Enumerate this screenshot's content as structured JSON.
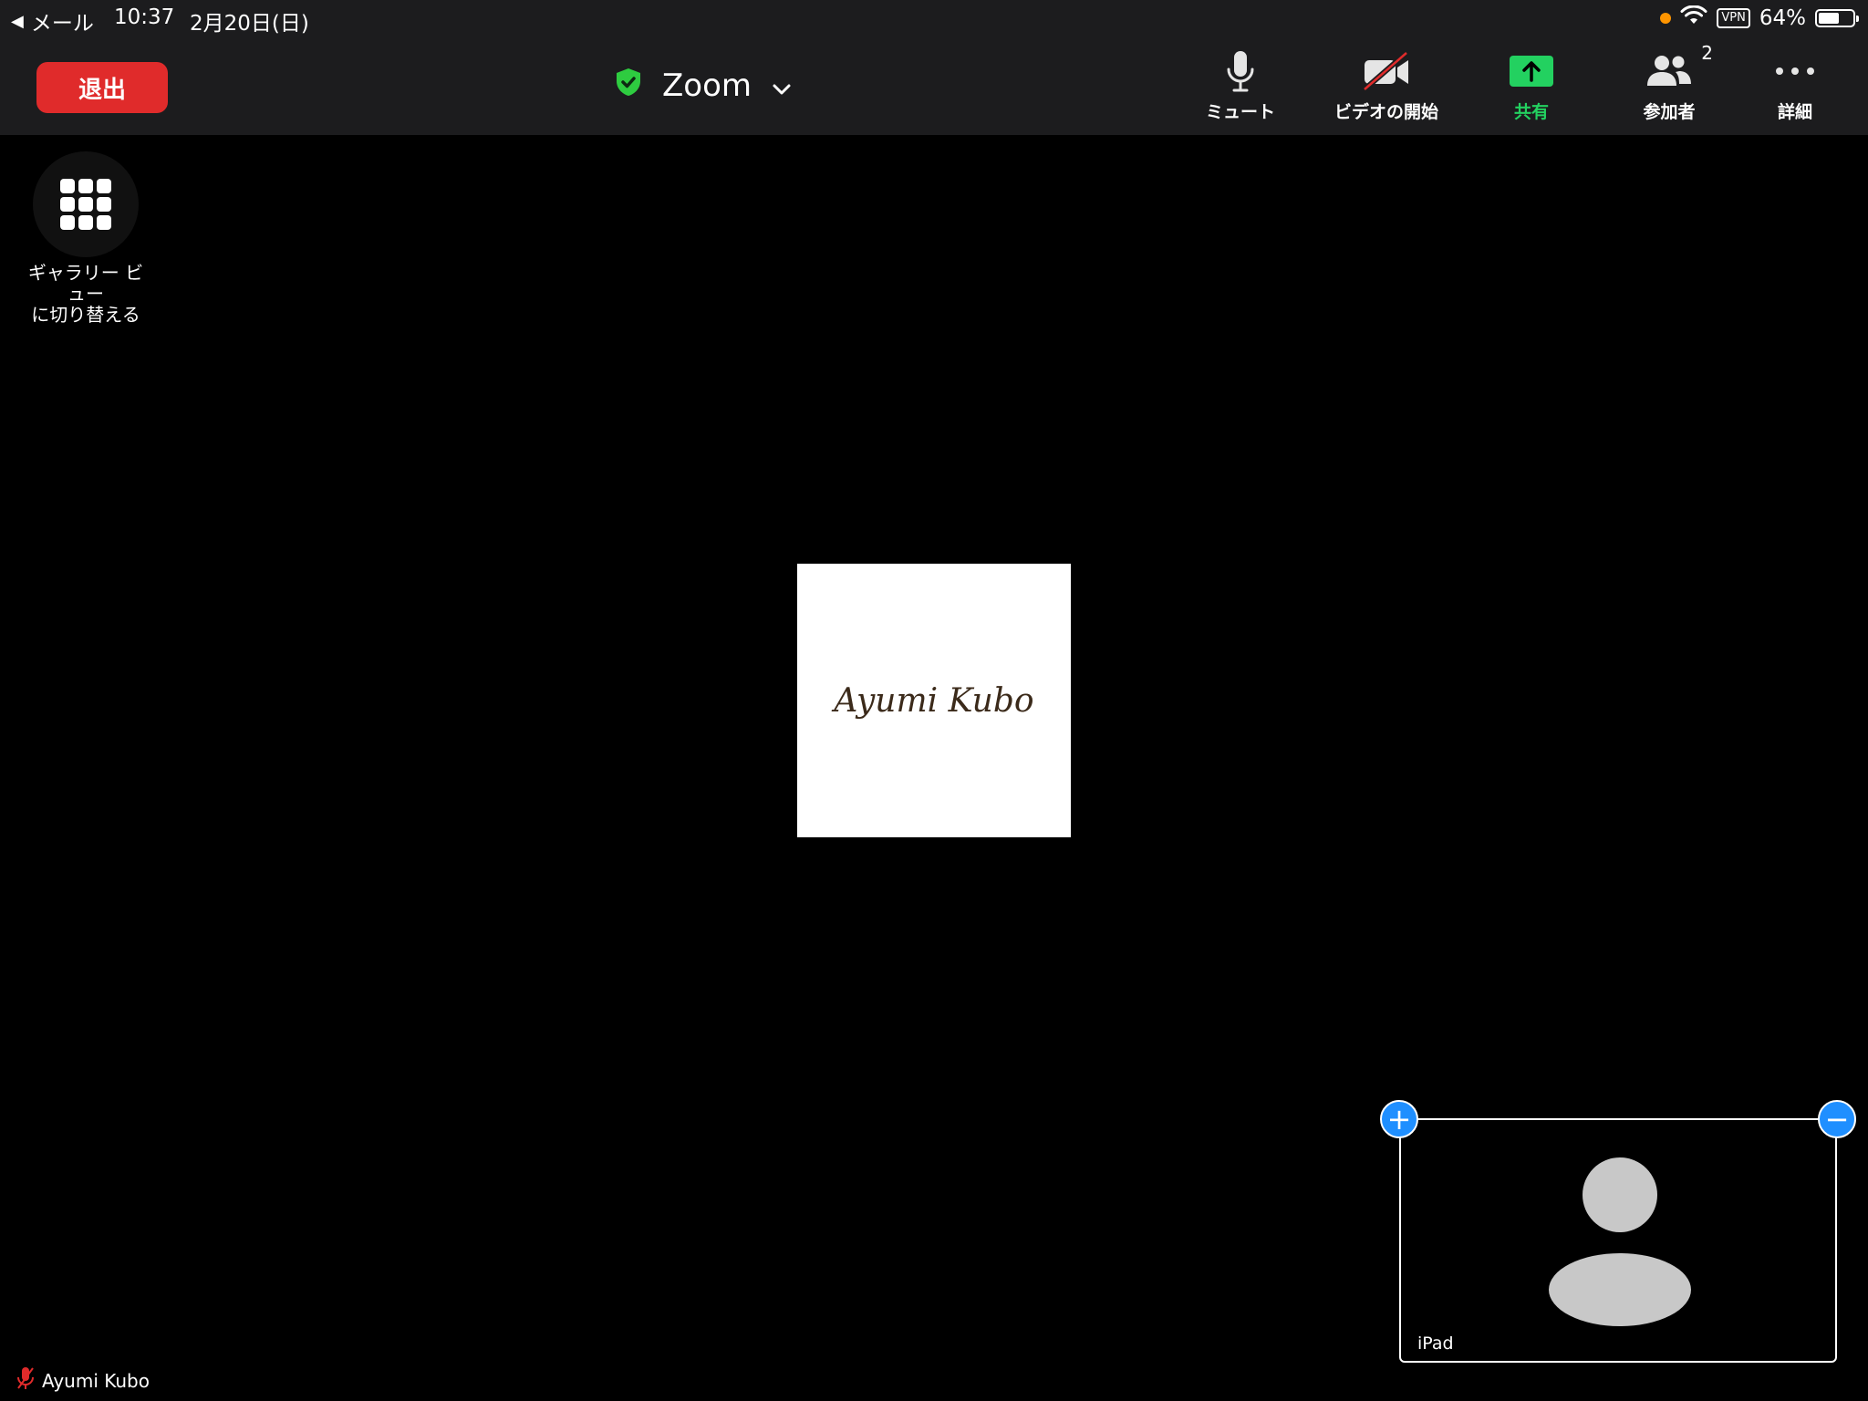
{
  "status_bar": {
    "back_label": "メール",
    "time": "10:37",
    "date": "2月20日(日)",
    "vpn": "VPN",
    "battery": "64%",
    "battery_level": 0.64,
    "indicator_color": "#ff9500"
  },
  "toolbar": {
    "leave_label": "退出",
    "meeting_title": "Zoom",
    "mute_label": "ミュート",
    "video_label": "ビデオの開始",
    "share_label": "共有",
    "participants_label": "参加者",
    "participants_count": "2",
    "more_label": "詳細"
  },
  "gallery": {
    "label_line1": "ギャラリー ビ",
    "label_line2": "ュー",
    "label_line3": "に切り替える"
  },
  "main_video": {
    "name": "Ayumi Kubo"
  },
  "self_view": {
    "label": "iPad"
  },
  "bottom": {
    "name": "Ayumi Kubo"
  },
  "colors": {
    "leave": "#e02b2b",
    "share": "#23d160",
    "shield": "#2ecc40",
    "corner_button": "#1f8fff",
    "muted_icon": "#e02b2b"
  }
}
